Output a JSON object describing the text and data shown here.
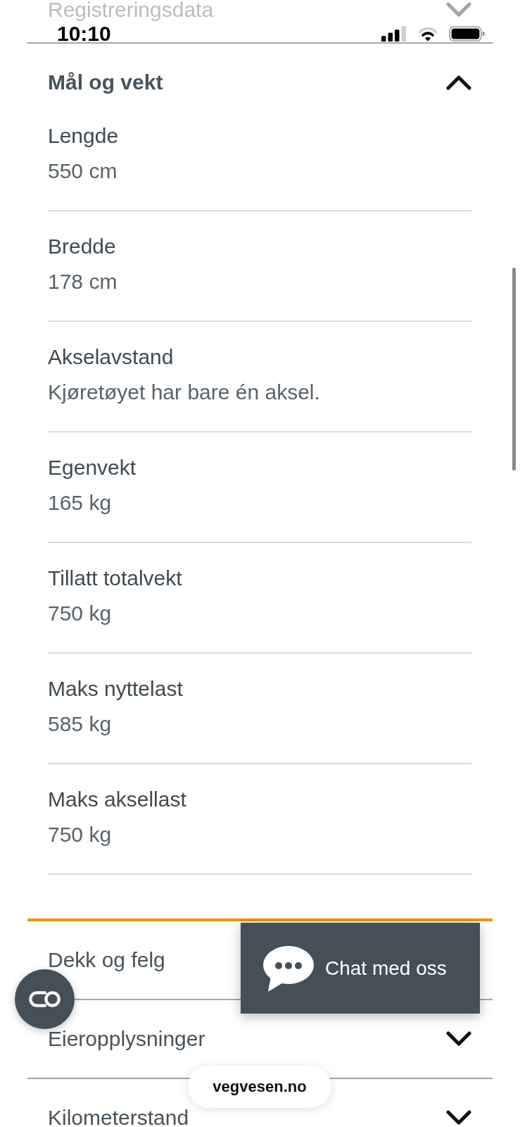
{
  "status_bar": {
    "time": "10:10"
  },
  "sections": [
    {
      "title": "Registreringsdata",
      "expanded": false
    },
    {
      "title": "Mål og vekt",
      "expanded": true,
      "fields": [
        {
          "label": "Lengde",
          "value": "550 cm"
        },
        {
          "label": "Bredde",
          "value": "178 cm"
        },
        {
          "label": "Akselavstand",
          "value": "Kjøretøyet har bare én aksel."
        },
        {
          "label": "Egenvekt",
          "value": "165 kg"
        },
        {
          "label": "Tillatt totalvekt",
          "value": "750 kg"
        },
        {
          "label": "Maks nyttelast",
          "value": "585 kg"
        },
        {
          "label": "Maks aksellast",
          "value": "750 kg"
        }
      ]
    },
    {
      "title": "Dekk og felg",
      "expanded": false
    },
    {
      "title": "Eieropplysninger",
      "expanded": false
    },
    {
      "title": "Kilometerstand",
      "expanded": false
    }
  ],
  "chat_button": {
    "label": "Chat med oss"
  },
  "address_bar": {
    "text": "vegvesen.no"
  }
}
